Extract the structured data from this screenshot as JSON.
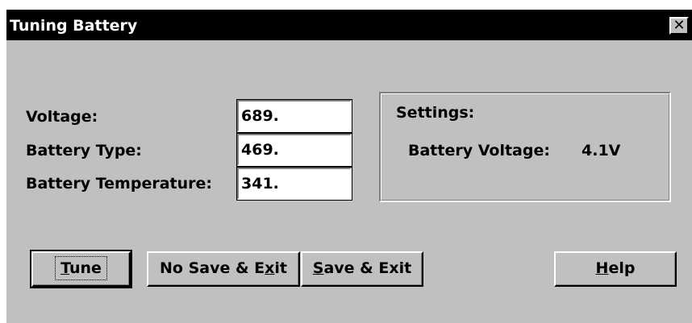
{
  "window": {
    "title": "Tuning Battery",
    "close_glyph": "✕"
  },
  "fields": [
    {
      "label": "Voltage:",
      "value": "689."
    },
    {
      "label": "Battery Type:",
      "value": "469."
    },
    {
      "label": "Battery Temperature:",
      "value": "341."
    }
  ],
  "settings": {
    "heading": "Settings:",
    "voltage_label": "Battery Voltage:",
    "voltage_value": "4.1V"
  },
  "buttons": {
    "tune": {
      "mnemonic": "T",
      "rest": "une"
    },
    "no_save_exit": {
      "before": "No Save & E",
      "mnemonic": "x",
      "after": "it"
    },
    "save_exit": {
      "mnemonic": "S",
      "rest": "ave & Exit"
    },
    "help": {
      "mnemonic": "H",
      "rest": "elp"
    }
  },
  "colors": {
    "titlebar": "#000000",
    "face": "#c0c0c0"
  }
}
